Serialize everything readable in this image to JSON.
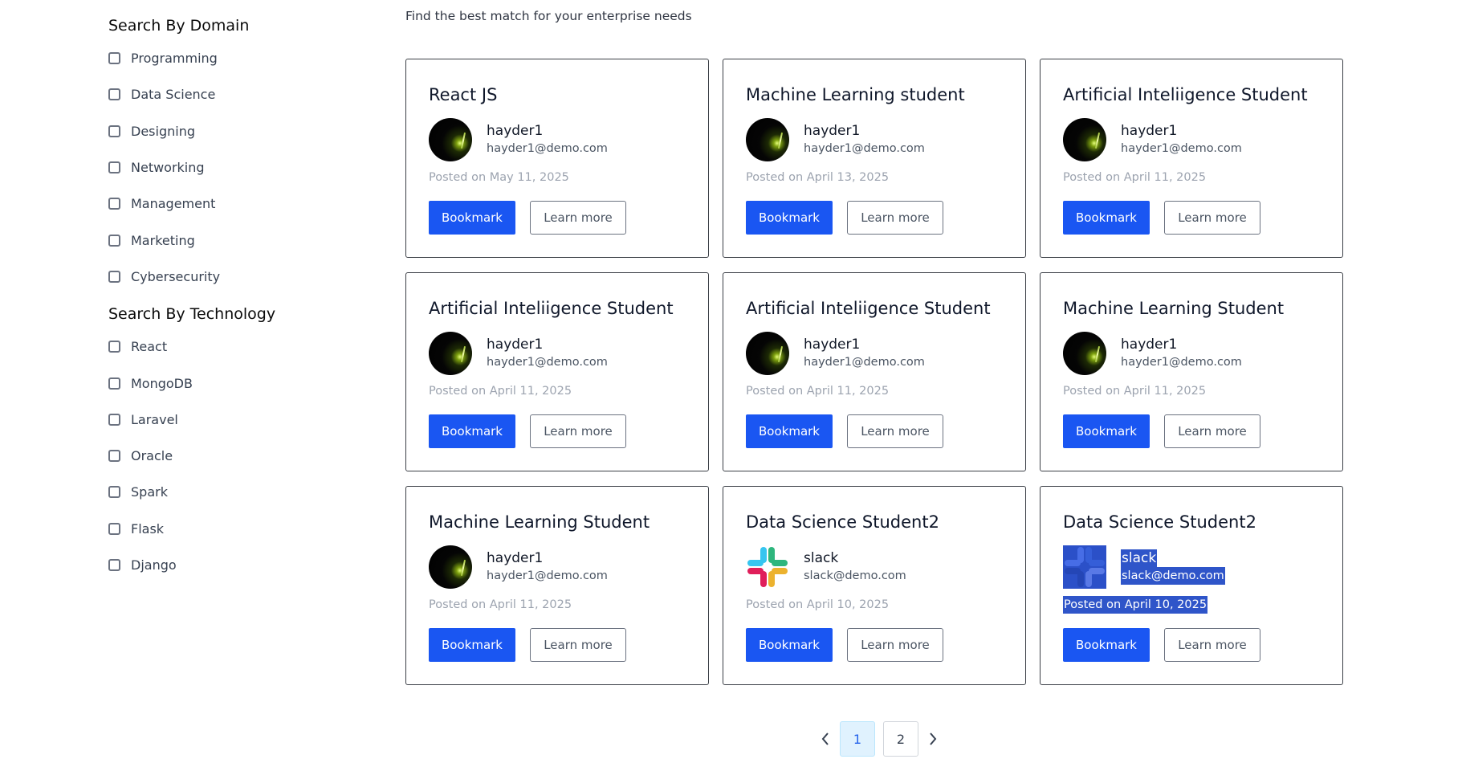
{
  "sidebar": {
    "domain_heading": "Search By Domain",
    "domains": [
      "Programming",
      "Data Science",
      "Designing",
      "Networking",
      "Management",
      "Marketing",
      "Cybersecurity"
    ],
    "technology_heading": "Search By Technology",
    "technologies": [
      "React",
      "MongoDB",
      "Laravel",
      "Oracle",
      "Spark",
      "Flask",
      "Django"
    ]
  },
  "main": {
    "tagline": "Find the best match for your enterprise needs",
    "cards": [
      {
        "title": "React JS",
        "author": "hayder1",
        "email": "hayder1@demo.com",
        "posted": "Posted on May 11, 2025",
        "avatar": "dark-glow-avatar",
        "bookmark": "Bookmark",
        "learn": "Learn more"
      },
      {
        "title": "Machine Learning student",
        "author": "hayder1",
        "email": "hayder1@demo.com",
        "posted": "Posted on April 13, 2025",
        "avatar": "dark-glow-avatar",
        "bookmark": "Bookmark",
        "learn": "Learn more"
      },
      {
        "title": "Artificial Inteliigence Student",
        "author": "hayder1",
        "email": "hayder1@demo.com",
        "posted": "Posted on April 11, 2025",
        "avatar": "dark-glow-avatar",
        "bookmark": "Bookmark",
        "learn": "Learn more"
      },
      {
        "title": "Artificial Inteliigence Student",
        "author": "hayder1",
        "email": "hayder1@demo.com",
        "posted": "Posted on April 11, 2025",
        "avatar": "dark-glow-avatar",
        "bookmark": "Bookmark",
        "learn": "Learn more"
      },
      {
        "title": "Artificial Inteliigence Student",
        "author": "hayder1",
        "email": "hayder1@demo.com",
        "posted": "Posted on April 11, 2025",
        "avatar": "dark-glow-avatar",
        "bookmark": "Bookmark",
        "learn": "Learn more"
      },
      {
        "title": "Machine Learning Student",
        "author": "hayder1",
        "email": "hayder1@demo.com",
        "posted": "Posted on April 11, 2025",
        "avatar": "dark-glow-avatar",
        "bookmark": "Bookmark",
        "learn": "Learn more"
      },
      {
        "title": "Machine Learning Student",
        "author": "hayder1",
        "email": "hayder1@demo.com",
        "posted": "Posted on April 11, 2025",
        "avatar": "dark-glow-avatar",
        "bookmark": "Bookmark",
        "learn": "Learn more"
      },
      {
        "title": "Data Science Student2",
        "author": "slack",
        "email": "slack@demo.com",
        "posted": "Posted on April 10, 2025",
        "avatar": "slack-logo",
        "bookmark": "Bookmark",
        "learn": "Learn more"
      },
      {
        "title": "Data Science Student2",
        "author": "slack",
        "email": "slack@demo.com",
        "posted": "Posted on April 10, 2025",
        "avatar": "slack-logo",
        "selected": true,
        "bookmark": "Bookmark",
        "learn": "Learn more"
      }
    ]
  },
  "pagination": {
    "prev_icon": "chevron-left-icon",
    "pages": [
      "1",
      "2"
    ],
    "active_page": "1",
    "next_icon": "chevron-right-icon"
  },
  "colors": {
    "primary": "#1a56f2",
    "selection": "#2f55c9",
    "active_page_bg": "#e0f2fe"
  }
}
